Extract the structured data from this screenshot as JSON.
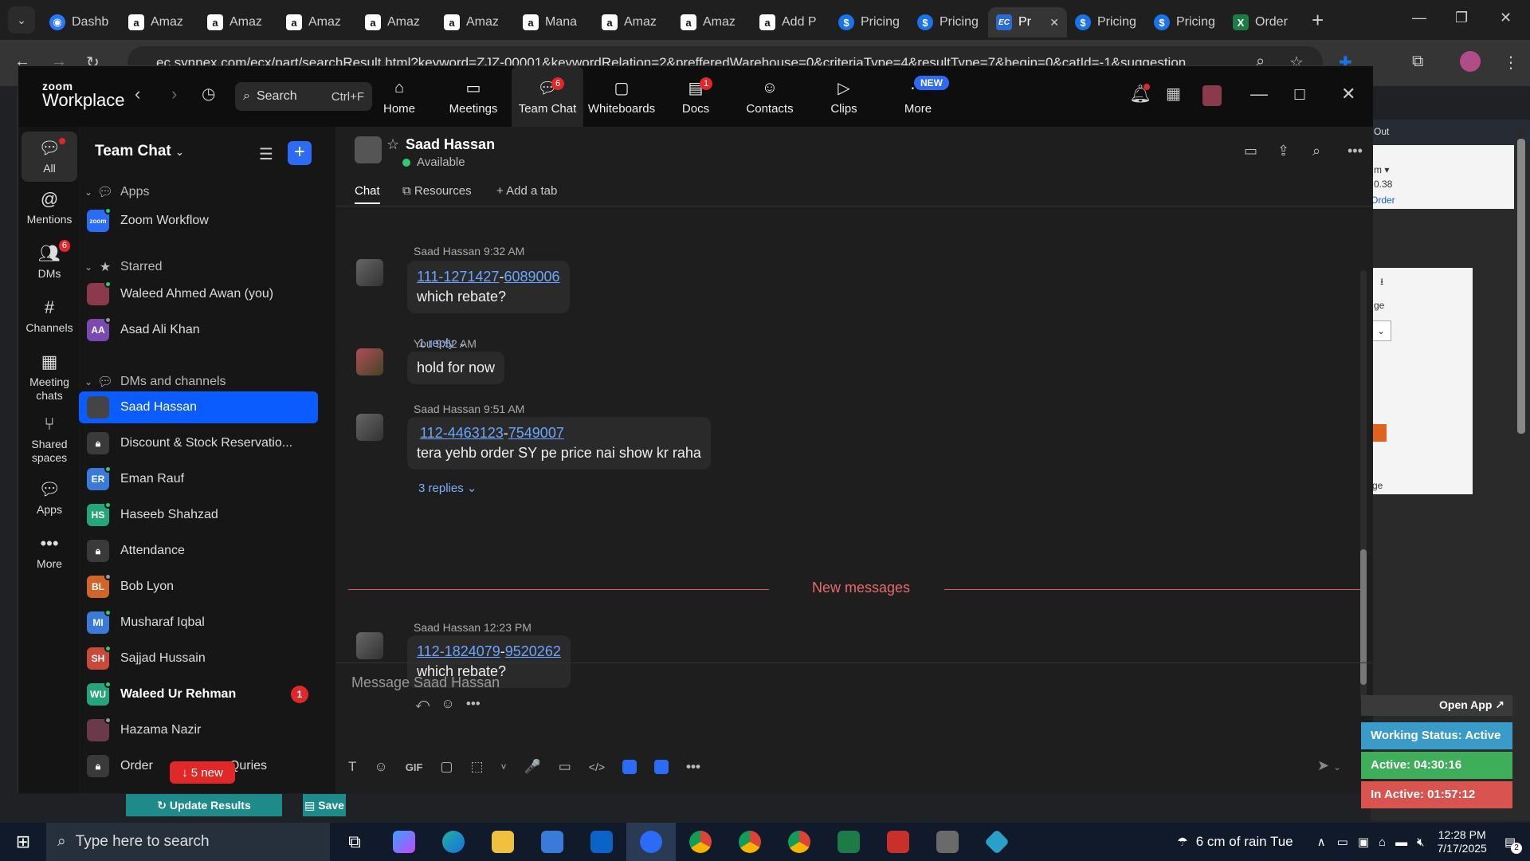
{
  "browser": {
    "tabs": [
      {
        "label": "Dashb",
        "fav": "dashboard-icon"
      },
      {
        "label": "Amaz",
        "fav": "amazon-icon"
      },
      {
        "label": "Amaz",
        "fav": "amazon-icon"
      },
      {
        "label": "Amaz",
        "fav": "amazon-icon"
      },
      {
        "label": "Amaz",
        "fav": "amazon-icon"
      },
      {
        "label": "Amaz",
        "fav": "amazon-icon"
      },
      {
        "label": "Mana",
        "fav": "amazon-icon"
      },
      {
        "label": "Amaz",
        "fav": "amazon-icon"
      },
      {
        "label": "Amaz",
        "fav": "amazon-icon"
      },
      {
        "label": "Add P",
        "fav": "amazon-icon"
      },
      {
        "label": "Pricing",
        "fav": "dollar-icon"
      },
      {
        "label": "Pricing",
        "fav": "dollar-icon"
      },
      {
        "label": "Pr",
        "fav": "ec-icon"
      },
      {
        "label": "Pricing",
        "fav": "dollar-icon"
      },
      {
        "label": "Pricing",
        "fav": "dollar-icon"
      },
      {
        "label": "Order",
        "fav": "excel-icon"
      }
    ],
    "url": "ec.synnex.com/ecx/part/searchResult.html?keyword=ZJZ-00001&keywordRelation=2&prefferedWarehouse=0&criteriaType=4&resultType=7&begin=0&catId=-1&suggestion"
  },
  "background_page": {
    "out": "Out",
    "m": "m ▾",
    "price": "0.38",
    "order": "Order",
    "ge1": "ge",
    "ge2": "ge",
    "update_btn": "Update Results",
    "save_btn": "Save"
  },
  "zoom": {
    "logo_top": "zoom",
    "logo_bottom": "Workplace",
    "search_label": "Search",
    "search_shortcut": "Ctrl+F",
    "tabs": [
      {
        "label": "Home",
        "badge": ""
      },
      {
        "label": "Meetings",
        "badge": ""
      },
      {
        "label": "Team Chat",
        "badge": "6"
      },
      {
        "label": "Whiteboards",
        "badge": ""
      },
      {
        "label": "Docs",
        "badge": "1"
      },
      {
        "label": "Contacts",
        "badge": ""
      },
      {
        "label": "Clips",
        "badge": ""
      },
      {
        "label": "More",
        "badge": "NEW"
      }
    ],
    "rail": [
      {
        "label": "All",
        "icon": "chat-icon",
        "badge": ""
      },
      {
        "label": "Mentions",
        "icon": "at-icon",
        "badge": ""
      },
      {
        "label": "DMs",
        "icon": "people-icon",
        "badge": "6"
      },
      {
        "label": "Channels",
        "icon": "hash-icon",
        "badge": ""
      },
      {
        "label": "Meeting chats",
        "icon": "calendar-icon",
        "badge": ""
      },
      {
        "label": "Shared spaces",
        "icon": "share-icon",
        "badge": ""
      },
      {
        "label": "Apps",
        "icon": "apps-icon",
        "badge": ""
      },
      {
        "label": "More",
        "icon": "more-icon",
        "badge": ""
      }
    ],
    "sidebar": {
      "title": "Team Chat",
      "sections": {
        "apps": "Apps",
        "starred": "Starred",
        "dms": "DMs and channels"
      },
      "apps_items": [
        {
          "label": "Zoom Workflow"
        }
      ],
      "starred_items": [
        {
          "label": "Waleed Ahmed Awan (you)",
          "initials": ""
        },
        {
          "label": "Asad Ali Khan",
          "initials": "AA"
        }
      ],
      "dm_items": [
        {
          "label": "Saad Hassan",
          "initials": "",
          "unread": ""
        },
        {
          "label": "Discount & Stock Reservatio...",
          "initials": "",
          "unread": ""
        },
        {
          "label": "Eman Rauf",
          "initials": "ER",
          "unread": ""
        },
        {
          "label": "Haseeb Shahzad",
          "initials": "HS",
          "unread": ""
        },
        {
          "label": "Attendance",
          "initials": "",
          "unread": ""
        },
        {
          "label": "Bob Lyon",
          "initials": "BL",
          "unread": ""
        },
        {
          "label": "Musharaf Iqbal",
          "initials": "MI",
          "unread": ""
        },
        {
          "label": "Sajjad Hussain",
          "initials": "SH",
          "unread": ""
        },
        {
          "label": "Waleed Ur Rehman",
          "initials": "WU",
          "unread": "1"
        },
        {
          "label": "Hazama Nazir",
          "initials": "",
          "unread": ""
        },
        {
          "label": "Order",
          "initials": "",
          "unread": ""
        }
      ],
      "last_item_suffix": "Quries",
      "new_pill": "↓ 5 new"
    },
    "chat": {
      "contact_name": "Saad Hassan",
      "status": "Available",
      "tabs": [
        "Chat",
        "Resources",
        "+ Add a tab"
      ],
      "messages": [
        {
          "sender": "Saad Hassan",
          "time": "9:32 AM",
          "link1": "111-1271427",
          "link2": "6089006",
          "text": "which rebate?",
          "replies": "1 reply"
        },
        {
          "sender": "You",
          "time": "9:52 AM",
          "text": "hold for now"
        },
        {
          "sender": "Saad Hassan",
          "time": "9:51 AM",
          "link1": "112-4463123",
          "link2": "7549007",
          "text": "tera yehb order SY pe price nai show kr raha",
          "replies": "3 replies"
        },
        {
          "sender": "Saad Hassan",
          "time": "12:23 PM",
          "link1": "112-1824079",
          "link2": "9520262",
          "text": "which rebate?"
        }
      ],
      "new_messages": "New messages",
      "compose_placeholder": "Message Saad Hassan",
      "compose_tools": [
        "T",
        "☺",
        "GIF",
        "▢",
        "⬚",
        "˅",
        "🎤",
        "▭",
        "</>",
        "",
        "",
        "•••"
      ]
    }
  },
  "widgets": {
    "open_app": "Open App ↗",
    "working_status": "Working Status: Active",
    "active": "Active: 04:30:16",
    "inactive": "In Active: 01:57:12",
    "colors": {
      "status": "#3a9bc8",
      "active": "#3fae5a",
      "inactive": "#d9534f"
    }
  },
  "taskbar": {
    "search_placeholder": "Type here to search",
    "weather": "6 cm of rain Tue",
    "time": "12:28 PM",
    "date": "7/17/2025",
    "notif_count": "2"
  }
}
